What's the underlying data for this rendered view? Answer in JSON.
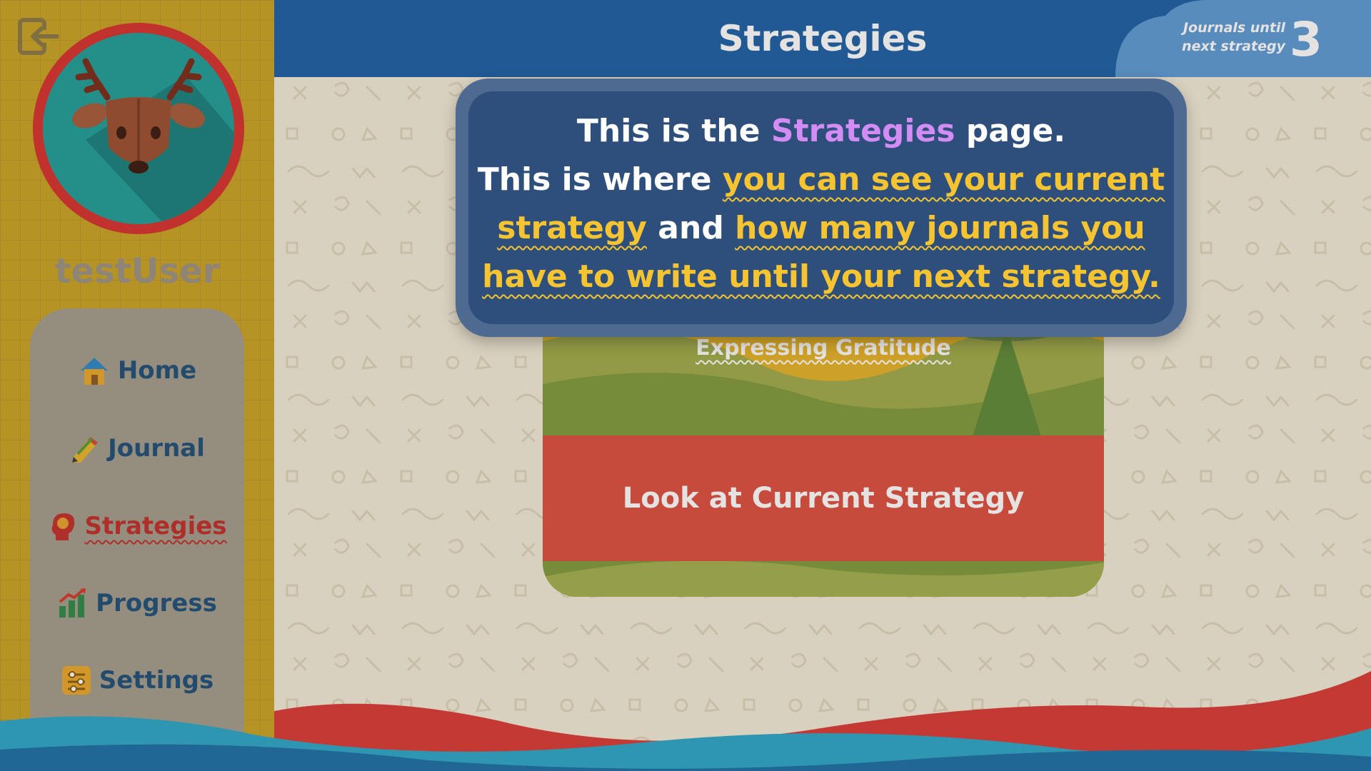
{
  "user": {
    "name": "testUser",
    "avatar": "deer-icon"
  },
  "sidebar": {
    "logout_icon": "logout-icon",
    "items": [
      {
        "label": "Home",
        "icon": "home-icon",
        "active": false
      },
      {
        "label": "Journal",
        "icon": "pencil-icon",
        "active": false
      },
      {
        "label": "Strategies",
        "icon": "head-icon",
        "active": true
      },
      {
        "label": "Progress",
        "icon": "chart-icon",
        "active": false
      },
      {
        "label": "Settings",
        "icon": "sliders-icon",
        "active": false
      }
    ]
  },
  "header": {
    "title": "Strategies",
    "counter_label_line1": "Journals until",
    "counter_label_line2": "next strategy",
    "counter_value": "3"
  },
  "card": {
    "strategy_name": "Expressing Gratitude",
    "button_label": "Look at Current Strategy"
  },
  "tutorial": {
    "line1_pre": "This is the",
    "line1_highlight": "Strategies",
    "line1_post": "page.",
    "line2_pre": "This is where",
    "line2_highlight1": "you can see your current strategy",
    "line2_mid": "and",
    "line2_highlight2": "how many journals you have to write until your next strategy."
  },
  "colors": {
    "header_blue": "#1a5fa6",
    "sidebar_gold": "#c9a225",
    "active_red": "#bf2d2b",
    "highlight_purple": "#d38cf4",
    "highlight_yellow": "#f5c430",
    "button_red": "#dc4e40"
  }
}
